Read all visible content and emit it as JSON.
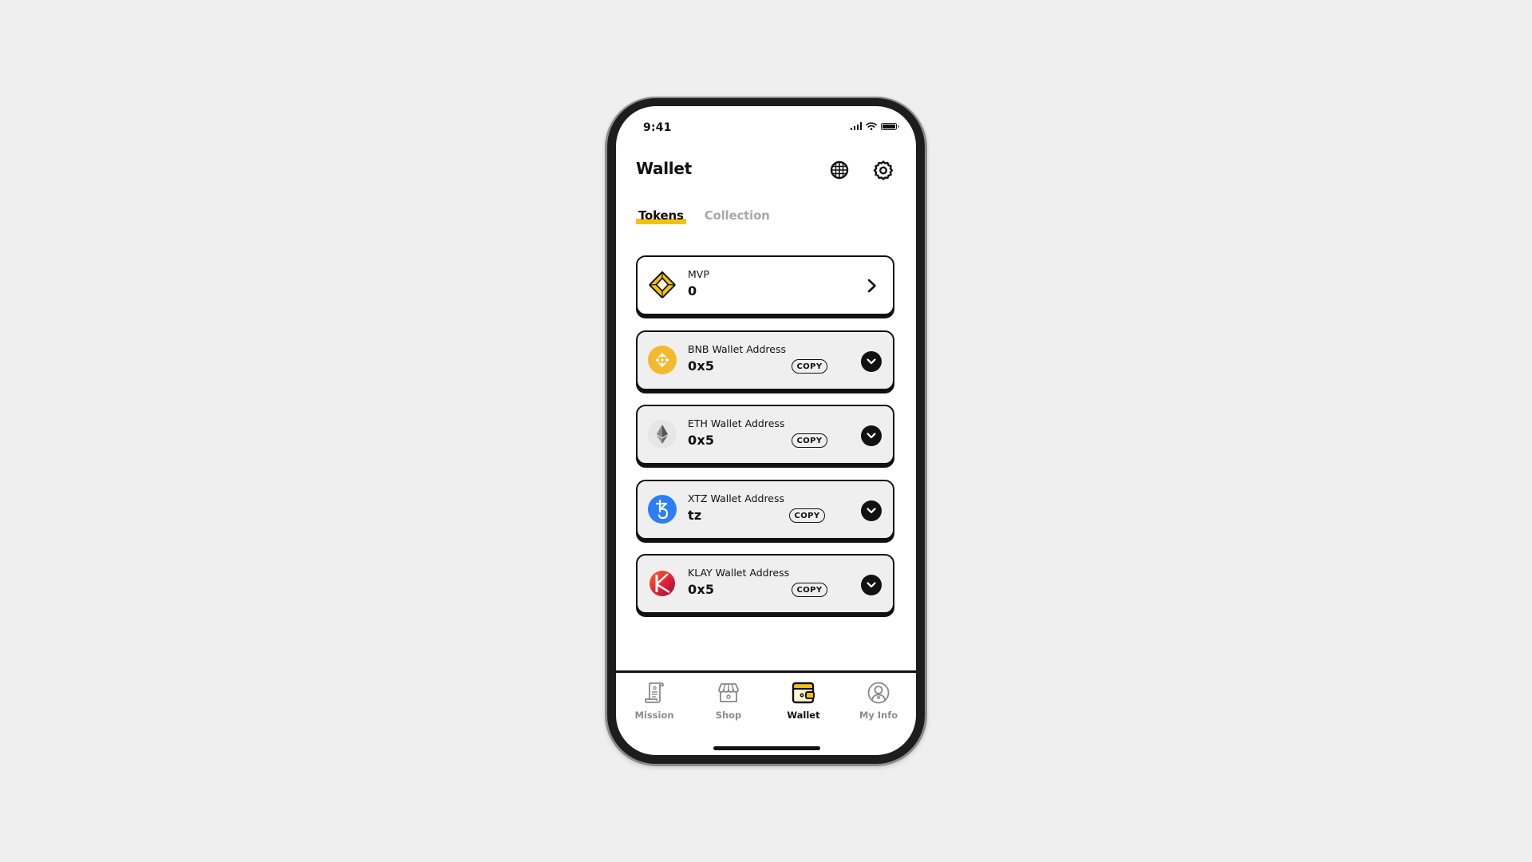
{
  "status_bar": {
    "time": "9:41"
  },
  "header": {
    "title": "Wallet",
    "icons": [
      "globe-icon",
      "gear-icon"
    ]
  },
  "tabs": [
    {
      "label": "Tokens",
      "active": true
    },
    {
      "label": "Collection",
      "active": false
    }
  ],
  "cards": [
    {
      "name": "mvp",
      "icon": "mvp-token-icon",
      "label": "MVP",
      "value": "0",
      "action": "chevron-right"
    },
    {
      "name": "bnb",
      "icon": "bnb-icon",
      "label": "BNB Wallet Address",
      "value": "0x5",
      "copy_label": "COPY",
      "action": "expand"
    },
    {
      "name": "eth",
      "icon": "eth-icon",
      "label": "ETH Wallet Address",
      "value": "0x5",
      "copy_label": "COPY",
      "action": "expand"
    },
    {
      "name": "xtz",
      "icon": "tezos-icon",
      "label": "XTZ Wallet Address",
      "value": "tz",
      "copy_label": "COPY",
      "action": "expand"
    },
    {
      "name": "klay",
      "icon": "klaytn-icon",
      "label": "KLAY Wallet Address",
      "value": "0x5",
      "copy_label": "COPY",
      "action": "expand"
    }
  ],
  "bottom_nav": [
    {
      "label": "Mission",
      "icon": "scroll-icon",
      "active": false
    },
    {
      "label": "Shop",
      "icon": "shop-icon",
      "active": false
    },
    {
      "label": "Wallet",
      "icon": "wallet-icon",
      "active": true
    },
    {
      "label": "My Info",
      "icon": "user-icon",
      "active": false
    }
  ],
  "colors": {
    "accent": "#f5c200",
    "bnb": "#f3ba2f",
    "tezos": "#2c7df7",
    "klay": "#e0203a",
    "inactive": "#8c8c8c",
    "background": "#efefef"
  }
}
